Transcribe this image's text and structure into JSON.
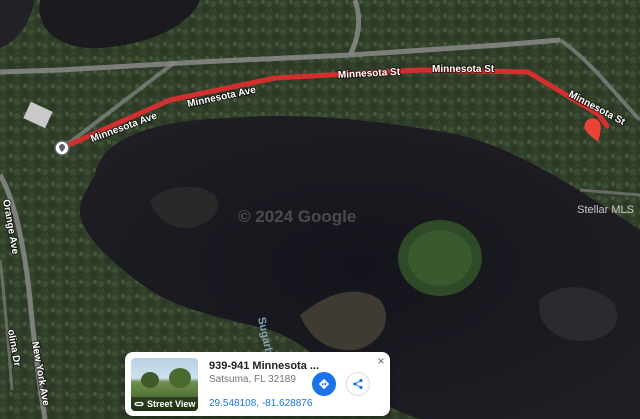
{
  "map": {
    "route_color": "#d32f2f",
    "roads": {
      "minnesota_ave_1": "Minnesota Ave",
      "minnesota_ave_2": "Minnesota Ave",
      "minnesota_st_1": "Minnesota St",
      "minnesota_st_2": "Minnesota St",
      "new_york_ave": "New York Ave",
      "orange_ave": "Orange Ave",
      "carolina_dr": "olina Dr"
    },
    "water_label": "Sugarb",
    "watermark": "© 2024 Google",
    "attribution": "Stellar MLS"
  },
  "card": {
    "title": "939-941 Minnesota ...",
    "subtitle": "Satsuma, FL 32189",
    "coordinates": "29.548108, -81.628876",
    "street_view_label": "Street View",
    "close_symbol": "×",
    "directions_icon": "directions-icon",
    "share_icon": "share-icon"
  }
}
